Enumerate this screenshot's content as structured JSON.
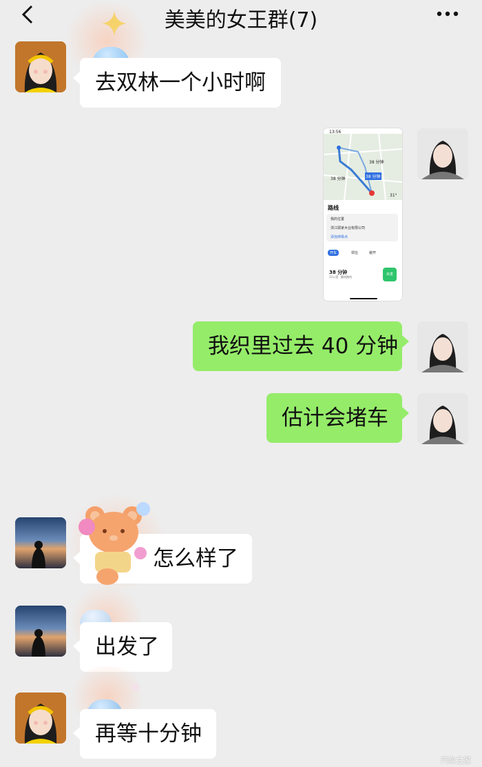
{
  "header": {
    "title": "美美的女王群(7)"
  },
  "messages": [
    {
      "side": "left",
      "text": "去双林一个小时啊"
    },
    {
      "side": "right",
      "type": "image"
    },
    {
      "side": "right",
      "text": "我织里过去 40 分钟"
    },
    {
      "side": "right",
      "text": "估计会堵车"
    },
    {
      "side": "left",
      "text": "怎么样了"
    },
    {
      "side": "left",
      "text": "出发了"
    },
    {
      "side": "left",
      "text": "再等十分钟"
    }
  ],
  "map_screenshot": {
    "status_time": "13:56",
    "route_label_1": "38 分钟",
    "route_label_1b": "最快",
    "route_label_2": "38 分钟",
    "route_label_2b": "备选",
    "route_label_3": "38 分钟",
    "route_label_3b": "备选",
    "temp": "31°",
    "section_title": "路线",
    "from": "我的位置",
    "to": "浙江顾家木业有限公司",
    "add_stop": "添加停靠点",
    "mode_drive": "开车",
    "option_now": "现在",
    "option_avoid": "避开",
    "duration": "38 分钟",
    "duration_sub": "22公里 · 最快路线",
    "go_button": "出发"
  },
  "colors": {
    "self_bubble": "#95ec69",
    "other_bubble": "#ffffff",
    "background": "#ededed"
  },
  "watermark": "汽车之家"
}
